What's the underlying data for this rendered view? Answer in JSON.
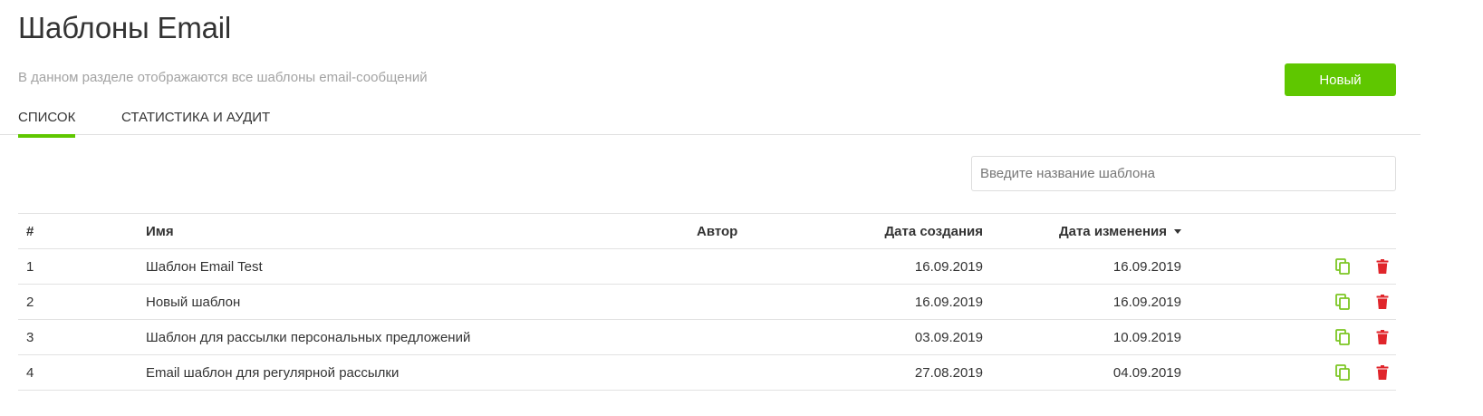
{
  "header": {
    "title": "Шаблоны Email",
    "subtitle": "В данном разделе отображаются все шаблоны email-сообщений",
    "new_button_label": "Новый"
  },
  "tabs": [
    {
      "label": "Список",
      "active": true
    },
    {
      "label": "Статистика и аудит",
      "active": false
    }
  ],
  "search": {
    "placeholder": "Введите название шаблона",
    "value": ""
  },
  "table": {
    "columns": [
      "#",
      "Имя",
      "Автор",
      "Дата создания",
      "Дата изменения"
    ],
    "sort_column": "Дата изменения",
    "sort_direction": "desc",
    "rows": [
      {
        "num": "1",
        "name": "Шаблон Email Test",
        "author": "",
        "created": "16.09.2019",
        "modified": "16.09.2019"
      },
      {
        "num": "2",
        "name": "Новый шаблон",
        "author": "",
        "created": "16.09.2019",
        "modified": "16.09.2019"
      },
      {
        "num": "3",
        "name": "Шаблон для рассылки персональных предложений",
        "author": "",
        "created": "03.09.2019",
        "modified": "10.09.2019"
      },
      {
        "num": "4",
        "name": "Email шаблон для регулярной рассылки",
        "author": "",
        "created": "27.08.2019",
        "modified": "04.09.2019"
      }
    ],
    "row_actions": [
      "copy-icon",
      "trash-icon"
    ]
  },
  "colors": {
    "accent": "#5fc700",
    "copy_icon": "#7cc623",
    "delete_icon": "#e0252b",
    "subtitle_text": "#a3a3a3"
  }
}
